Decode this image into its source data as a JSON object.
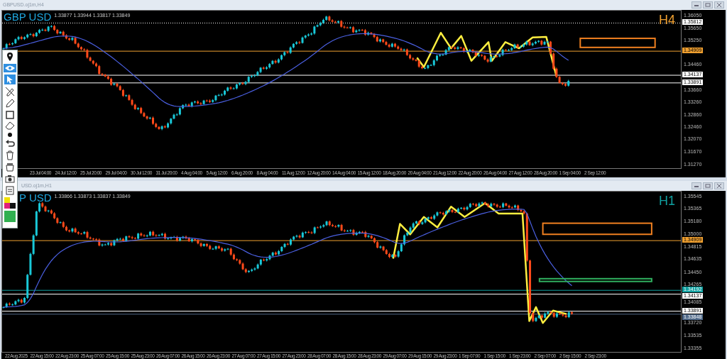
{
  "windows": [
    {
      "title": "GBPUSD.oj1m,H4",
      "symbol": "GBP USD",
      "quote": "1.33877 1.33944 1.33817 1.33849",
      "timeframe": {
        "label": "H4",
        "color": "#f0a030"
      },
      "price_ticks": [
        "1.36050",
        "1.35650",
        "1.35250",
        "1.34460",
        "1.33660",
        "1.33260",
        "1.32860",
        "1.32460",
        "1.32070",
        "1.31670",
        "1.31270"
      ],
      "levels": [
        {
          "label": "1.35812",
          "color": "#ffffff",
          "kind": "dotted"
        },
        {
          "label": "1.34909",
          "color": "#f0a030",
          "kind": "solid"
        },
        {
          "label": "1.34137",
          "color": "#ffffff",
          "kind": "solid"
        },
        {
          "label": "1.33891",
          "color": "#ffffff",
          "kind": "solid"
        }
      ],
      "time_labels": [
        "23 Jul 04:00",
        "24 Jul 12:00",
        "25 Jul 20:00",
        "29 Jul 04:00",
        "30 Jul 12:00",
        "31 Jul 20:00",
        "4 Aug 04:00",
        "5 Aug 12:00",
        "6 Aug 20:00",
        "8 Aug 04:00",
        "11 Aug 12:00",
        "12 Aug 20:00",
        "14 Aug 04:00",
        "15 Aug 12:00",
        "18 Aug 20:00",
        "20 Aug 04:00",
        "21 Aug 12:00",
        "22 Aug 20:00",
        "26 Aug 04:00",
        "27 Aug 12:00",
        "28 Aug 20:00",
        "1 Sep 04:00",
        "2 Sep 12:00"
      ]
    },
    {
      "title": "USD.oj1m,H1",
      "symbol": "P USD",
      "quote": "1.33866 1.33873 1.33837 1.33849",
      "timeframe": {
        "label": "H1",
        "color": "#10a0a0"
      },
      "price_ticks": [
        "1.35545",
        "1.35365",
        "1.35180",
        "1.35000",
        "1.34815",
        "1.34635",
        "1.34450",
        "1.34265",
        "1.34085",
        "1.33720",
        "1.33535",
        "1.33355"
      ],
      "levels": [
        {
          "label": "1.34909",
          "color": "#f0a030",
          "kind": "solid"
        },
        {
          "label": "1.34192",
          "color": "#10a0a0",
          "kind": "solid"
        },
        {
          "label": "1.34137",
          "color": "#ffffff",
          "kind": "solid"
        },
        {
          "label": "1.33891",
          "color": "#ffffff",
          "kind": "solid"
        },
        {
          "label": "1.33848",
          "color": "#506a8a",
          "kind": "solid"
        }
      ],
      "time_labels": [
        "22 Aug 2025",
        "22 Aug 15:00",
        "22 Aug 23:00",
        "25 Aug 07:00",
        "25 Aug 15:00",
        "25 Aug 23:00",
        "26 Aug 07:00",
        "26 Aug 15:00",
        "26 Aug 23:00",
        "27 Aug 07:00",
        "27 Aug 15:00",
        "27 Aug 23:00",
        "28 Aug 07:00",
        "28 Aug 15:00",
        "28 Aug 23:00",
        "29 Aug 07:00",
        "29 Aug 15:00",
        "29 Aug 23:00",
        "1 Sep 07:00",
        "1 Sep 15:00",
        "1 Sep 23:00",
        "2 Sep 07:00",
        "2 Sep 15:00",
        "2 Sep 23:00"
      ]
    }
  ]
}
